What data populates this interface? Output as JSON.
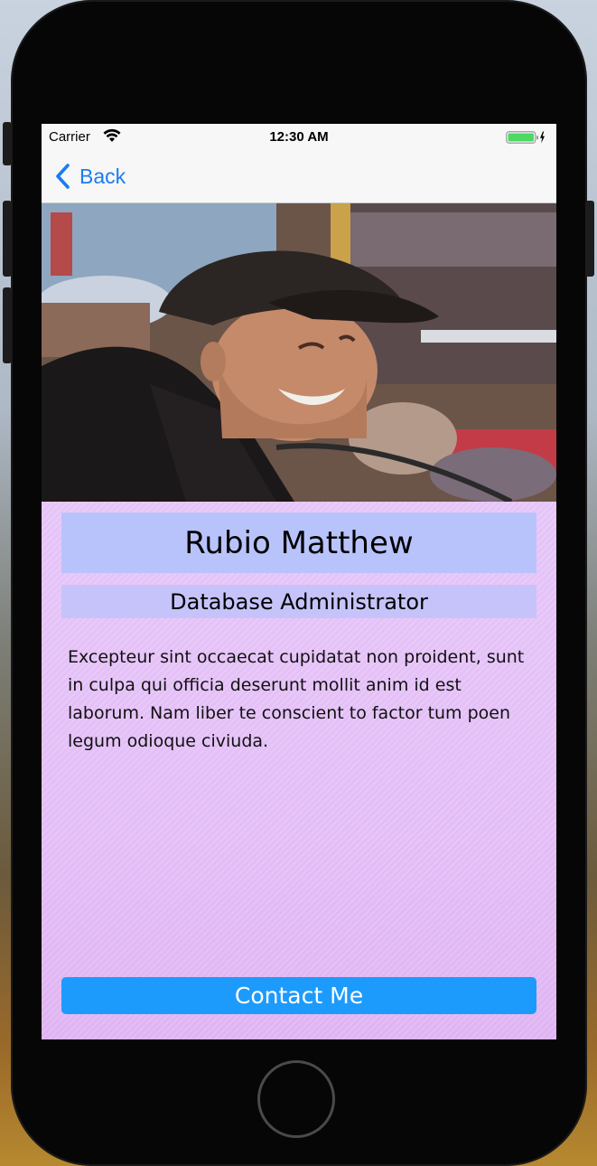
{
  "status_bar": {
    "carrier": "Carrier",
    "time": "12:30 AM",
    "wifi_icon": "wifi-icon",
    "battery_icon": "battery-charging-icon"
  },
  "nav": {
    "back_label": "Back",
    "back_icon": "chevron-left-icon"
  },
  "profile": {
    "name": "Rubio Matthew",
    "title": "Database Administrator",
    "bio": "Excepteur sint occaecat cupidatat non proident, sunt in culpa qui officia deserunt mollit anim id est laborum. Nam liber te conscient to factor tum poen legum odioque civiuda.",
    "photo": "profile-photo"
  },
  "actions": {
    "contact_label": "Contact Me"
  },
  "colors": {
    "accent": "#1a7cf2",
    "button": "#1d9bfd",
    "name_bg": "#b9c3fb",
    "title_bg": "#c6c3fa",
    "content_bg": "#e7c2fa",
    "battery": "#4cd964"
  }
}
